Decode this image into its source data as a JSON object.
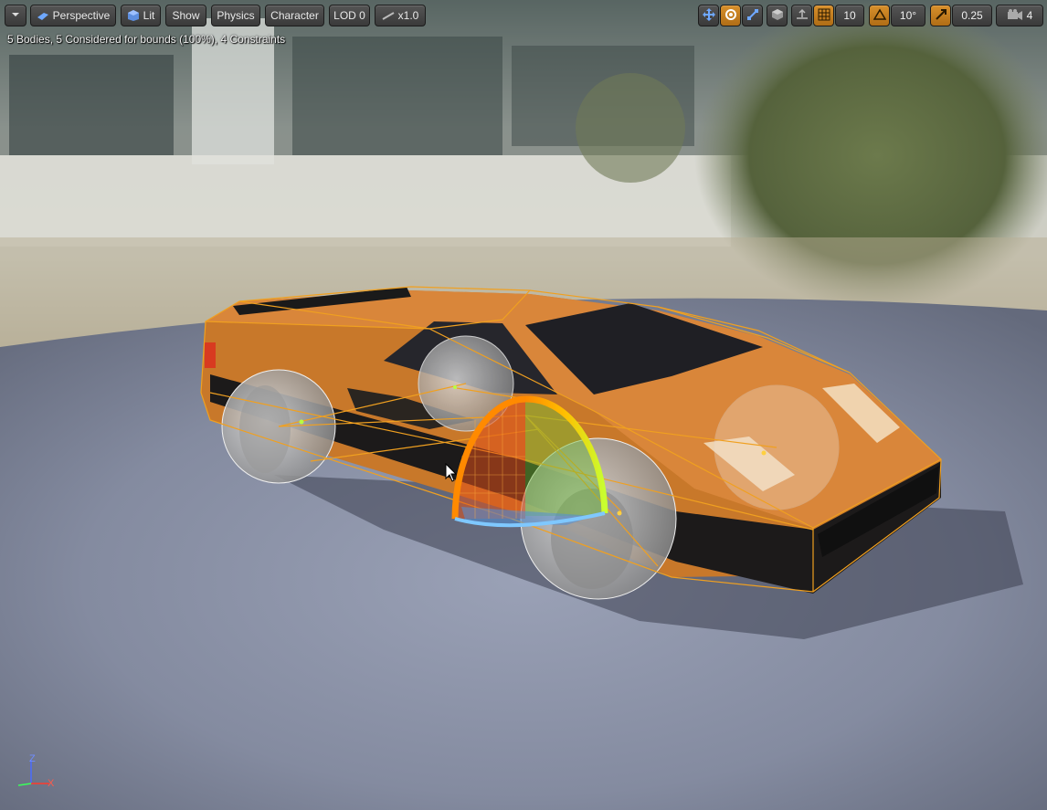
{
  "toolbar": {
    "menu_icon": "chevron-down-icon",
    "view_mode_label": "Perspective",
    "lit_label": "Lit",
    "show_label": "Show",
    "physics_label": "Physics",
    "character_label": "Character",
    "lod_label": "LOD 0",
    "speed_label": "x1.0",
    "grid_snap_value": "10",
    "rotation_snap_value": "10°",
    "scale_snap_value": "0.25",
    "camera_speed_value": "4"
  },
  "stats_text": "5 Bodies, 5 Considered for bounds (100%), 4 Constraints",
  "axis": {
    "z": "Z",
    "x": "X"
  },
  "colors": {
    "accent_active": "#d8902c",
    "collision_outline": "#f0a020",
    "car_body": "#c8782a",
    "ground": "#8a91a6"
  }
}
